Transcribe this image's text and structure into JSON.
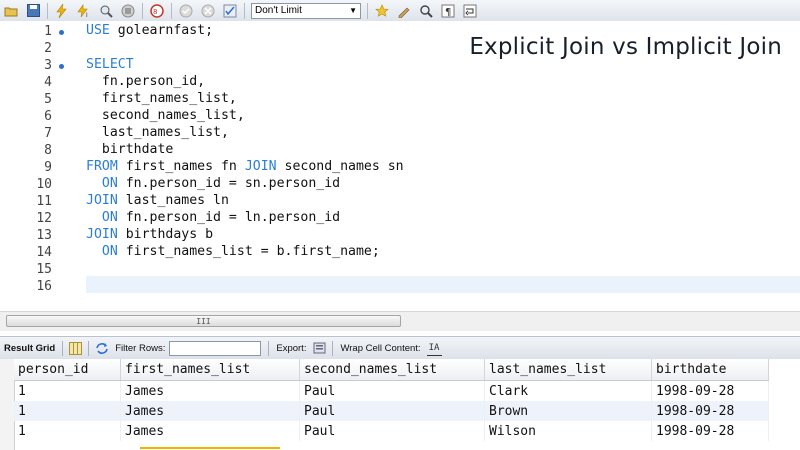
{
  "toolbar": {
    "limit_value": "Don't Limit",
    "icons": [
      "open-folder-icon",
      "save-icon",
      "execute-lightning-icon",
      "execute-current-icon",
      "explain-magnifier-icon",
      "stop-icon",
      "toggle-results-icon",
      "commit-icon",
      "rollback-icon",
      "autocommit-icon",
      "bookmark-star-icon",
      "beautify-icon",
      "find-icon",
      "invisible-chars-icon",
      "wrap-icon"
    ]
  },
  "title": "Explicit Join vs Implicit Join",
  "editor": {
    "line_numbers": [
      "1",
      "2",
      "3",
      "4",
      "5",
      "6",
      "7",
      "8",
      "9",
      "10",
      "11",
      "12",
      "13",
      "14",
      "15",
      "16"
    ],
    "lines": [
      [
        {
          "t": "USE",
          "k": true
        },
        {
          "t": " golearnfast;",
          "k": false
        }
      ],
      [],
      [
        {
          "t": "SELECT",
          "k": true
        }
      ],
      [
        {
          "t": "  fn.person_id,",
          "k": false
        }
      ],
      [
        {
          "t": "  first_names_list,",
          "k": false
        }
      ],
      [
        {
          "t": "  second_names_list,",
          "k": false
        }
      ],
      [
        {
          "t": "  last_names_list,",
          "k": false
        }
      ],
      [
        {
          "t": "  birthdate",
          "k": false
        }
      ],
      [
        {
          "t": "FROM",
          "k": true
        },
        {
          "t": " first_names fn ",
          "k": false
        },
        {
          "t": "JOIN",
          "k": true
        },
        {
          "t": " second_names sn",
          "k": false
        }
      ],
      [
        {
          "t": "  ",
          "k": false
        },
        {
          "t": "ON",
          "k": true
        },
        {
          "t": " fn.person_id = sn.person_id",
          "k": false
        }
      ],
      [
        {
          "t": "JOIN",
          "k": true
        },
        {
          "t": " last_names ln",
          "k": false
        }
      ],
      [
        {
          "t": "  ",
          "k": false
        },
        {
          "t": "ON",
          "k": true
        },
        {
          "t": " fn.person_id = ln.person_id",
          "k": false
        }
      ],
      [
        {
          "t": "JOIN",
          "k": true
        },
        {
          "t": " birthdays b",
          "k": false
        }
      ],
      [
        {
          "t": "  ",
          "k": false
        },
        {
          "t": "ON",
          "k": true
        },
        {
          "t": " first_names_list = b.first_name;",
          "k": false
        }
      ],
      [],
      []
    ],
    "fold_markers": [
      1,
      3
    ]
  },
  "scrollbar": {
    "thumb_label": "III"
  },
  "result_bar": {
    "result_grid_label": "Result Grid",
    "filter_rows_label": "Filter Rows:",
    "export_label": "Export:",
    "wrap_label": "Wrap Cell Content:",
    "wrap_icon_glyph": "IA"
  },
  "grid": {
    "columns": [
      "person_id",
      "first_names_list",
      "second_names_list",
      "last_names_list",
      "birthdate"
    ],
    "rows": [
      [
        "1",
        "James",
        "Paul",
        "Clark",
        "1998-09-28"
      ],
      [
        "1",
        "James",
        "Paul",
        "Brown",
        "1998-09-28"
      ],
      [
        "1",
        "James",
        "Paul",
        "Wilson",
        "1998-09-28"
      ]
    ]
  }
}
